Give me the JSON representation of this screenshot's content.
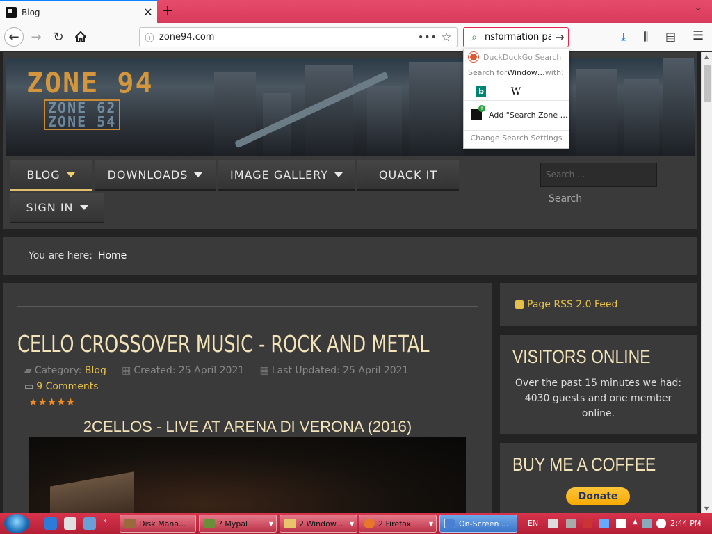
{
  "browser": {
    "tab_title": "Blog",
    "tab_close": "✕",
    "new_tab": "+",
    "minimize": "⌄",
    "url": "zone94.com",
    "search_value": "nsformation pa",
    "toolbar_icons": [
      "back-icon",
      "forward-icon",
      "reload-icon",
      "home-icon",
      "info-icon",
      "page-actions-icon",
      "bookmark-star-icon",
      "search-icon",
      "go-arrow-icon",
      "download-icon",
      "library-icon",
      "sidebar-icon",
      "hamburger-menu-icon"
    ]
  },
  "search_popup": {
    "engine": "DuckDuckGo Search",
    "search_for_prefix": "Search for ",
    "search_for_term": "Window…",
    "search_for_suffix": " with:",
    "bing_label": "b",
    "wiki_label": "W",
    "add_label": "Add \"Search Zone …",
    "settings_label": "Change Search Settings"
  },
  "site": {
    "logo_main": "ZONE 94",
    "logo_sub_1": "ZONE 62",
    "logo_sub_2": "ZONE 54",
    "nav": [
      {
        "label": "BLOG",
        "caret": true
      },
      {
        "label": "DOWNLOADS",
        "caret": true
      },
      {
        "label": "IMAGE GALLERY",
        "caret": true
      },
      {
        "label": "QUACK IT",
        "caret": false
      },
      {
        "label": "SIGN IN",
        "caret": true
      }
    ],
    "search_placeholder": "Search ...",
    "search_button": "Search",
    "breadcrumb_prefix": "You are here:",
    "breadcrumb_home": "Home"
  },
  "article": {
    "title": "CELLO CROSSOVER MUSIC - ROCK AND METAL",
    "category_label": "Category:",
    "category": "Blog",
    "created": "Created: 25 April 2021",
    "updated": "Last Updated: 25 April 2021",
    "comments": "9 Comments",
    "stars": "★★★★★",
    "rating": 5,
    "rating_max": 5,
    "video_title": "2CELLOS - LIVE AT ARENA DI VERONA (2016)"
  },
  "sidebar": {
    "rss": "Page RSS 2.0 Feed",
    "visitors_title": "VISITORS ONLINE",
    "visitors_text": "Over the past 15 minutes we had: 4030 guests and one member online.",
    "coffee_title": "BUY ME A COFFEE",
    "donate": "Donate"
  },
  "taskbar": {
    "buttons": [
      {
        "label": "Disk Mana...",
        "color": "#9a6b3a"
      },
      {
        "label": "? Mypal",
        "color": "#6b8e3a"
      },
      {
        "label": "2 Window...",
        "color": "#e8c46a"
      },
      {
        "label": "2 Firefox",
        "color": "#e8762b"
      },
      {
        "label": "On-Screen ...",
        "color": "#4a7fd4"
      }
    ],
    "lang": "EN",
    "time": "2:44 PM"
  },
  "colors": {
    "accent_gold": "#e6c04a",
    "title_cream": "#f3e3b8",
    "taskbar_red": "#c42a42",
    "tab_accent": "#0a84ff"
  }
}
